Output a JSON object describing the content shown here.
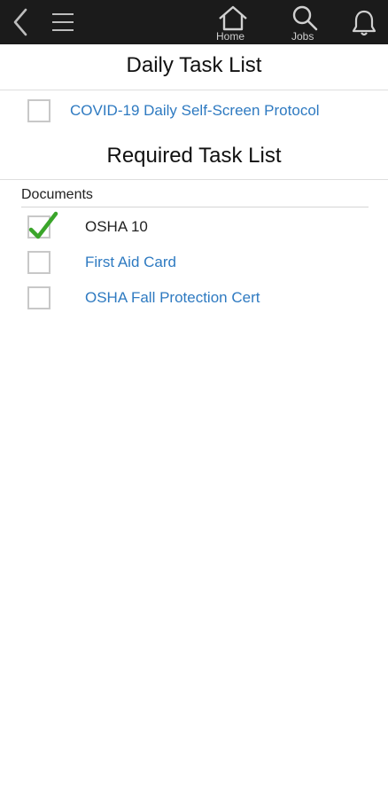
{
  "topbar": {
    "back_icon": "chevron-left-icon",
    "menu_icon": "hamburger-icon",
    "home_label": "Home",
    "jobs_label": "Jobs",
    "bell_icon": "bell-icon",
    "background": "#1b1b1b"
  },
  "daily": {
    "title": "Daily Task List",
    "tasks": [
      {
        "label": "COVID-19 Daily Self-Screen Protocol",
        "checked": false,
        "link": true
      }
    ]
  },
  "required": {
    "title": "Required Task List",
    "group_label": "Documents",
    "tasks": [
      {
        "label": "OSHA 10",
        "checked": true,
        "link": false
      },
      {
        "label": "First Aid Card",
        "checked": false,
        "link": true
      },
      {
        "label": "OSHA Fall Protection Cert",
        "checked": false,
        "link": true
      }
    ]
  },
  "colors": {
    "link": "#2e7ac1",
    "check": "#3aa52a",
    "checkbox_border": "#c8c8c8"
  }
}
